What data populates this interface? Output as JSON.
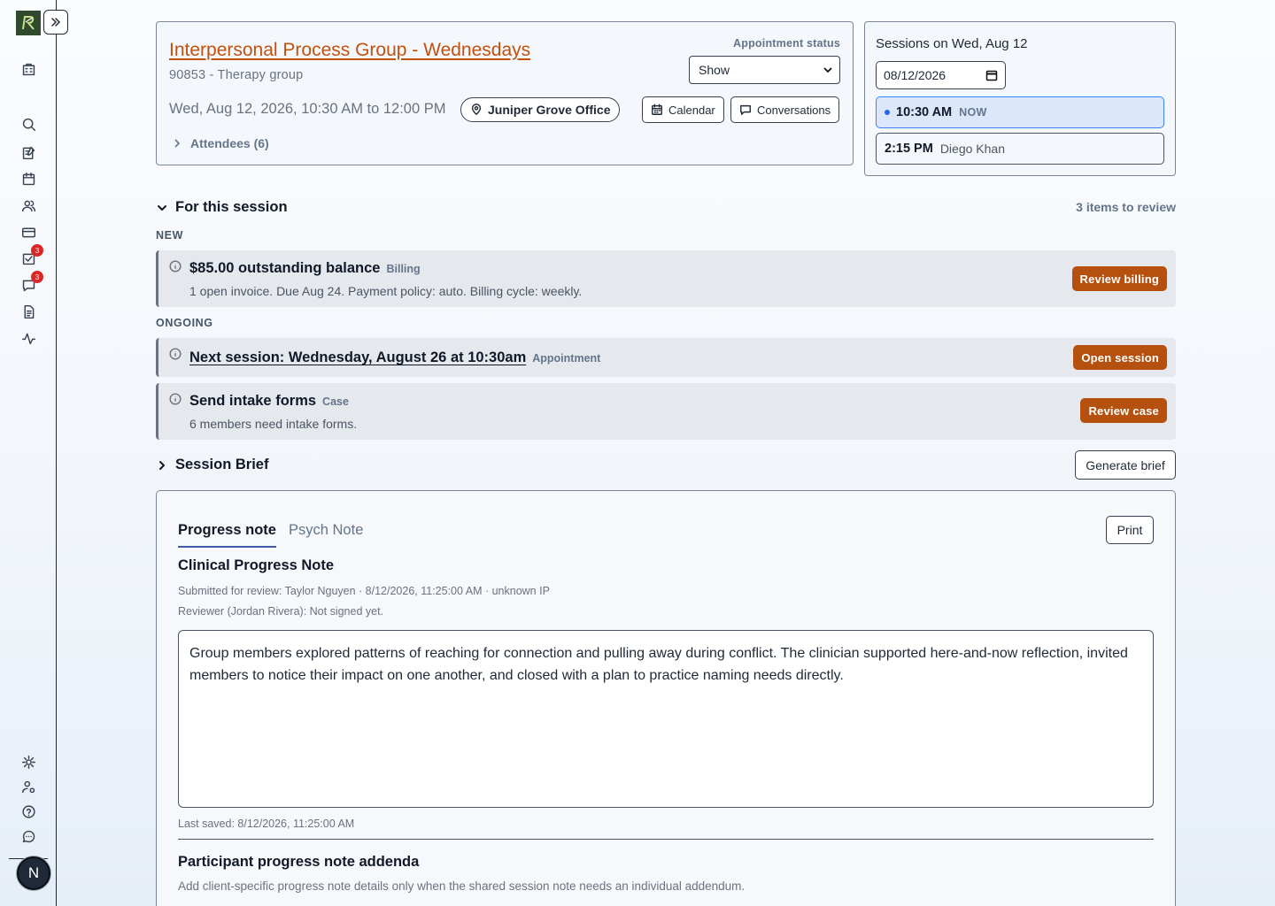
{
  "colors": {
    "accent": "#c2510e",
    "primary_button": "#b5500f",
    "active_slot": "#dbe7fb",
    "badge": "#dc2626"
  },
  "sidebar": {
    "expand_icon": "chevrons-right-icon",
    "items": [
      {
        "name": "building-icon"
      },
      {
        "name": "search-icon"
      },
      {
        "name": "notes-icon"
      },
      {
        "name": "calendar-icon"
      },
      {
        "name": "users-icon"
      },
      {
        "name": "billing-icon"
      },
      {
        "name": "tasks-icon",
        "badge": "3"
      },
      {
        "name": "messages-icon",
        "badge": "3"
      },
      {
        "name": "document-icon"
      },
      {
        "name": "activity-icon"
      },
      {
        "name": "settings-icon"
      },
      {
        "name": "user-settings-icon"
      },
      {
        "name": "help-icon"
      },
      {
        "name": "chat-icon"
      }
    ],
    "avatar_initial": "N"
  },
  "appointment": {
    "title": "Interpersonal Process Group - Wednesdays",
    "code": "90853 - Therapy group",
    "status_label": "Appointment status",
    "status_value": "Show",
    "time": "Wed, Aug 12, 2026, 10:30 AM to 12:00 PM",
    "location": "Juniper Grove Office",
    "calendar_label": "Calendar",
    "conversations_label": "Conversations",
    "attendees_label": "Attendees (6)"
  },
  "sessions": {
    "title": "Sessions on Wed, Aug 12",
    "date_value": "08/12/2026",
    "slots": [
      {
        "time": "10:30 AM",
        "label": "NOW"
      },
      {
        "time": "2:15 PM",
        "label": "Diego Khan"
      }
    ]
  },
  "review": {
    "heading": "For this session",
    "count": "3 items to review",
    "new_label": "NEW",
    "ongoing_label": "ONGOING",
    "items": [
      {
        "title": "$85.00 outstanding balance",
        "tag": "Billing",
        "desc": "1 open invoice. Due Aug 24. Payment policy: auto. Billing cycle: weekly.",
        "action": "Review billing"
      },
      {
        "title": "Next session: Wednesday, August 26 at 10:30am",
        "tag": "Appointment",
        "desc": "",
        "action": "Open session"
      },
      {
        "title": "Send intake forms",
        "tag": "Case",
        "desc": "6 members need intake forms.",
        "action": "Review case"
      }
    ]
  },
  "brief": {
    "heading": "Session Brief",
    "generate_label": "Generate brief"
  },
  "note": {
    "tabs": [
      "Progress note",
      "Psych Note"
    ],
    "print_label": "Print",
    "title": "Clinical Progress Note",
    "submitted": "Submitted for review: Taylor Nguyen · 8/12/2026, 11:25:00 AM · unknown IP",
    "reviewer": "Reviewer (Jordan Rivera): Not signed yet.",
    "body": "Group members explored patterns of reaching for connection and pulling away during conflict. The clinician supported here-and-now reflection, invited members to notice their impact on one another, and closed with a plan to practice naming needs directly.",
    "last_saved": "Last saved: 8/12/2026, 11:25:00 AM",
    "addenda_title": "Participant progress note addenda",
    "addenda_desc": "Add client-specific progress note details only when the shared session note needs an individual addendum."
  }
}
